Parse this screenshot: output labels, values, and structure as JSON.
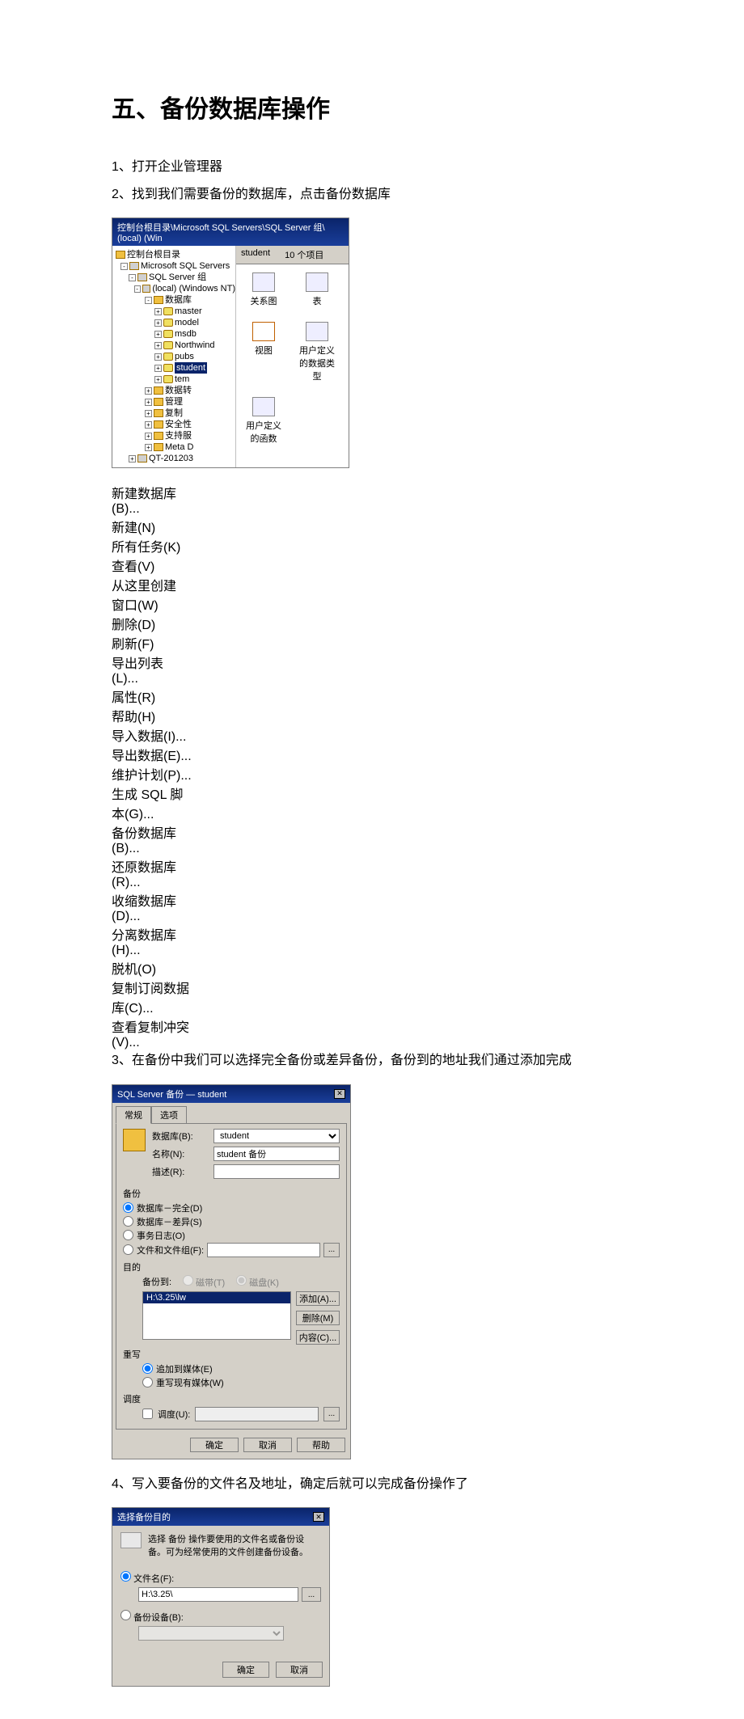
{
  "heading": "五、备份数据库操作",
  "steps": {
    "s1": "1、打开企业管理器",
    "s2": "2、找到我们需要备份的数据库，点击备份数据库",
    "s3": "3、在备份中我们可以选择完全备份或差异备份，备份到的地址我们通过添加完成",
    "s4": "4、写入要备份的文件名及地址，确定后就可以完成备份操作了"
  },
  "shot1": {
    "title": "控制台根目录\\Microsoft SQL Servers\\SQL Server 组\\(local) (Win",
    "tree": {
      "root": "控制台根目录",
      "srvs": "Microsoft SQL Servers",
      "grp": "SQL Server 组",
      "local": "(local) (Windows NT)",
      "dbfolder": "数据库",
      "dbs": [
        "master",
        "model",
        "msdb",
        "Northwind",
        "pubs",
        "student",
        "tem"
      ],
      "others": [
        "数据转",
        "管理",
        "复制",
        "安全性",
        "支持服",
        "Meta D"
      ],
      "qt": "QT-201203"
    },
    "right": {
      "header_db": "student",
      "header_cnt": "10 个项目",
      "items": [
        "关系图",
        "表",
        "视图",
        "用户定义的数据类型",
        "用户定义的函数"
      ]
    },
    "menu1": {
      "new_db": "新建数据库(B)...",
      "new": "新建(N)",
      "all_tasks": "所有任务(K)",
      "view": "查看(V)",
      "new_window": "从这里创建窗口(W)",
      "delete": "删除(D)",
      "refresh": "刷新(F)",
      "export_list": "导出列表(L)...",
      "properties": "属性(R)",
      "help": "帮助(H)"
    },
    "menu2": {
      "import": "导入数据(I)...",
      "export": "导出数据(E)...",
      "maint": "维护计划(P)...",
      "gen_sql": "生成 SQL 脚本(G)...",
      "backup": "备份数据库(B)...",
      "restore": "还原数据库(R)...",
      "shrink": "收缩数据库(D)...",
      "detach": "分离数据库(H)...",
      "offline": "脱机(O)",
      "copy_sub": "复制订阅数据库(C)...",
      "view_conflict": "查看复制冲突(V)..."
    }
  },
  "shot2": {
    "title": "SQL Server 备份 — student",
    "tabs": {
      "general": "常规",
      "options": "选项"
    },
    "labels": {
      "db": "数据库(B):",
      "name": "名称(N):",
      "desc": "描述(R):"
    },
    "values": {
      "db": "student",
      "name": "student 备份",
      "desc": ""
    },
    "sec_backup": "备份",
    "radios_backup": {
      "full": "数据库－完全(D)",
      "diff": "数据库－差异(S)",
      "log": "事务日志(O)",
      "file": "文件和文件组(F):"
    },
    "sec_dest": "目的",
    "backup_to": "备份到:",
    "tape": "磁带(T)",
    "disk": "磁盘(K)",
    "dest_item": "H:\\3.25\\lw",
    "btn_add": "添加(A)...",
    "btn_remove": "删除(M)",
    "btn_contents": "内容(C)...",
    "sec_overwrite": "重写",
    "ow_append": "追加到媒体(E)",
    "ow_overwrite": "重写现有媒体(W)",
    "sec_sched": "调度",
    "chk_sched": "调度(U):",
    "btn_ok": "确定",
    "btn_cancel": "取消",
    "btn_help": "帮助"
  },
  "shot3": {
    "title": "选择备份目的",
    "hint": "选择 备份 操作要使用的文件名或备份设备。可为经常使用的文件创建备份设备。",
    "opt_file": "文件名(F):",
    "file_value": "H:\\3.25\\",
    "opt_device": "备份设备(B):",
    "btn_ok": "确定",
    "btn_cancel": "取消"
  }
}
